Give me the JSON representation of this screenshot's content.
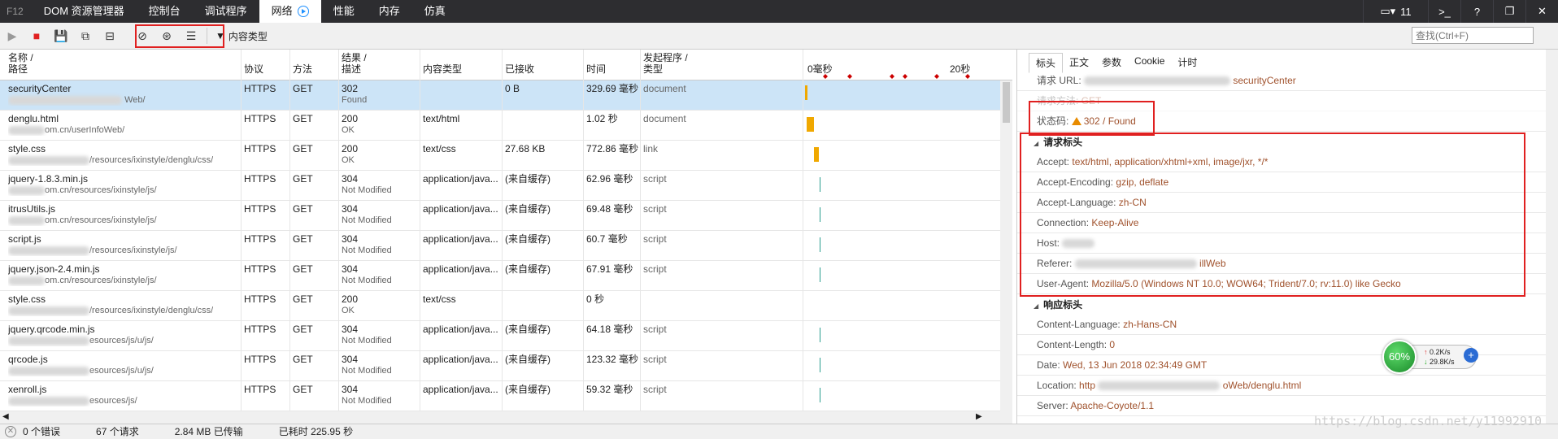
{
  "devtools": {
    "f12": "F12",
    "tabs": [
      "DOM 资源管理器",
      "控制台",
      "调试程序",
      "网络",
      "性能",
      "内存",
      "仿真"
    ],
    "active_tab": "网络",
    "window_count": "11",
    "help": "?"
  },
  "toolbar": {
    "filter_label": "内容类型",
    "search_placeholder": "查找(Ctrl+F)"
  },
  "columns": {
    "name": "名称 /",
    "name2": "路径",
    "protocol": "协议",
    "method": "方法",
    "result": "结果 /",
    "result2": "描述",
    "content_type": "内容类型",
    "received": "已接收",
    "time": "时间",
    "initiator": "发起程序 /",
    "initiator2": "类型",
    "timeline_start": "0毫秒",
    "timeline_mid": "20秒"
  },
  "rows": [
    {
      "name": "securityCenter",
      "path": "Web/",
      "protocol": "HTTPS",
      "method": "GET",
      "result": "302",
      "desc": "Found",
      "type": "",
      "received": "0 B",
      "time": "329.69 毫秒",
      "initiator": "document"
    },
    {
      "name": "denglu.html",
      "path": "om.cn/userInfoWeb/",
      "protocol": "HTTPS",
      "method": "GET",
      "result": "200",
      "desc": "OK",
      "type": "text/html",
      "received": "",
      "time": "1.02 秒",
      "initiator": "document"
    },
    {
      "name": "style.css",
      "path": "/resources/ixinstyle/denglu/css/",
      "protocol": "HTTPS",
      "method": "GET",
      "result": "200",
      "desc": "OK",
      "type": "text/css",
      "received": "27.68 KB",
      "time": "772.86 毫秒",
      "initiator": "link"
    },
    {
      "name": "jquery-1.8.3.min.js",
      "path": "om.cn/resources/ixinstyle/js/",
      "protocol": "HTTPS",
      "method": "GET",
      "result": "304",
      "desc": "Not Modified",
      "type": "application/java...",
      "received": "(来自缓存)",
      "time": "62.96 毫秒",
      "initiator": "script"
    },
    {
      "name": "itrusUtils.js",
      "path": "om.cn/resources/ixinstyle/js/",
      "protocol": "HTTPS",
      "method": "GET",
      "result": "304",
      "desc": "Not Modified",
      "type": "application/java...",
      "received": "(来自缓存)",
      "time": "69.48 毫秒",
      "initiator": "script"
    },
    {
      "name": "script.js",
      "path": "/resources/ixinstyle/js/",
      "protocol": "HTTPS",
      "method": "GET",
      "result": "304",
      "desc": "Not Modified",
      "type": "application/java...",
      "received": "(来自缓存)",
      "time": "60.7 毫秒",
      "initiator": "script"
    },
    {
      "name": "jquery.json-2.4.min.js",
      "path": "om.cn/resources/ixinstyle/js/",
      "protocol": "HTTPS",
      "method": "GET",
      "result": "304",
      "desc": "Not Modified",
      "type": "application/java...",
      "received": "(来自缓存)",
      "time": "67.91 毫秒",
      "initiator": "script"
    },
    {
      "name": "style.css",
      "path": "/resources/ixinstyle/denglu/css/",
      "protocol": "HTTPS",
      "method": "GET",
      "result": "200",
      "desc": "OK",
      "type": "text/css",
      "received": "",
      "time": "0 秒",
      "initiator": ""
    },
    {
      "name": "jquery.qrcode.min.js",
      "path": "esources/js/u/js/",
      "protocol": "HTTPS",
      "method": "GET",
      "result": "304",
      "desc": "Not Modified",
      "type": "application/java...",
      "received": "(来自缓存)",
      "time": "64.18 毫秒",
      "initiator": "script"
    },
    {
      "name": "qrcode.js",
      "path": "esources/js/u/js/",
      "protocol": "HTTPS",
      "method": "GET",
      "result": "304",
      "desc": "Not Modified",
      "type": "application/java...",
      "received": "(来自缓存)",
      "time": "123.32 毫秒",
      "initiator": "script"
    },
    {
      "name": "xenroll.js",
      "path": "esources/js/",
      "protocol": "HTTPS",
      "method": "GET",
      "result": "304",
      "desc": "Not Modified",
      "type": "application/java...",
      "received": "(来自缓存)",
      "time": "59.32 毫秒",
      "initiator": "script"
    }
  ],
  "detail": {
    "tabs": [
      "标头",
      "正文",
      "参数",
      "Cookie",
      "计时"
    ],
    "request_url_label": "请求 URL:",
    "request_url_value": "securityCenter",
    "request_method_label": "请求方法:",
    "request_method_value": "GET",
    "status_label": "状态码:",
    "status_value": "302 / Found",
    "req_headers_title": "请求标头",
    "req_headers": [
      {
        "k": "Accept:",
        "v": "text/html, application/xhtml+xml, image/jxr, */*"
      },
      {
        "k": "Accept-Encoding:",
        "v": "gzip, deflate"
      },
      {
        "k": "Accept-Language:",
        "v": "zh-CN"
      },
      {
        "k": "Connection:",
        "v": "Keep-Alive"
      },
      {
        "k": "Host:",
        "v": ""
      },
      {
        "k": "Referer:",
        "v": "illWeb"
      },
      {
        "k": "User-Agent:",
        "v": "Mozilla/5.0 (Windows NT 10.0; WOW64; Trident/7.0; rv:11.0) like Gecko"
      }
    ],
    "resp_headers_title": "响应标头",
    "resp_headers": [
      {
        "k": "Content-Language:",
        "v": "zh-Hans-CN"
      },
      {
        "k": "Content-Length:",
        "v": "0"
      },
      {
        "k": "Date:",
        "v": "Wed, 13 Jun 2018 02:34:49 GMT"
      },
      {
        "k": "Location:",
        "v": "http",
        "v2": "oWeb/denglu.html"
      },
      {
        "k": "Server:",
        "v": "Apache-Coyote/1.1"
      }
    ]
  },
  "status": {
    "errors": "0 个错误",
    "requests": "67 个请求",
    "transferred": "2.84 MB 已传输",
    "elapsed": "已耗时 225.95 秒"
  },
  "widget": {
    "percent": "60%",
    "up": "0.2K/s",
    "down": "29.8K/s"
  },
  "watermark": "https://blog.csdn.net/y11992910"
}
